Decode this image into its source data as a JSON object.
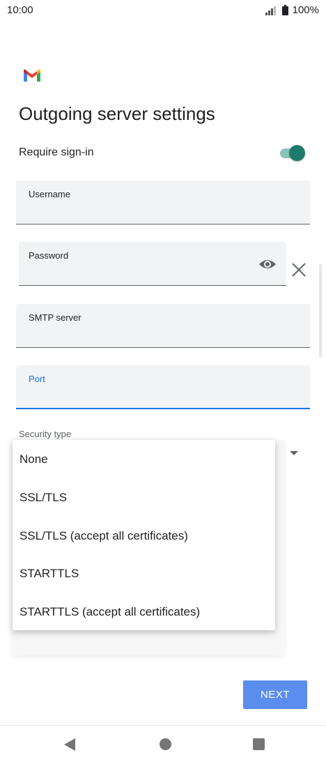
{
  "status_bar": {
    "time": "10:00",
    "battery": "100%"
  },
  "title": "Outgoing server settings",
  "require_signin": {
    "label": "Require sign-in",
    "enabled": true
  },
  "fields": {
    "username": {
      "label": "Username",
      "value": ""
    },
    "password": {
      "label": "Password",
      "value": ""
    },
    "smtp_server": {
      "label": "SMTP server",
      "value": ""
    },
    "port": {
      "label": "Port",
      "value": ""
    }
  },
  "security_type": {
    "label": "Security type",
    "options": [
      "None",
      "SSL/TLS",
      "SSL/TLS (accept all certificates)",
      "STARTTLS",
      "STARTTLS (accept all certificates)"
    ]
  },
  "next_button": {
    "label": "NEXT"
  },
  "colors": {
    "accent": "#1a73e8",
    "toggle_on": "#1e7a6a",
    "next_button": "#5b8def"
  },
  "icons": [
    "gmail-logo-icon",
    "signal-icon",
    "battery-icon",
    "eye-icon",
    "close-icon",
    "dropdown-arrow-icon",
    "back-icon",
    "home-icon",
    "recents-icon"
  ]
}
